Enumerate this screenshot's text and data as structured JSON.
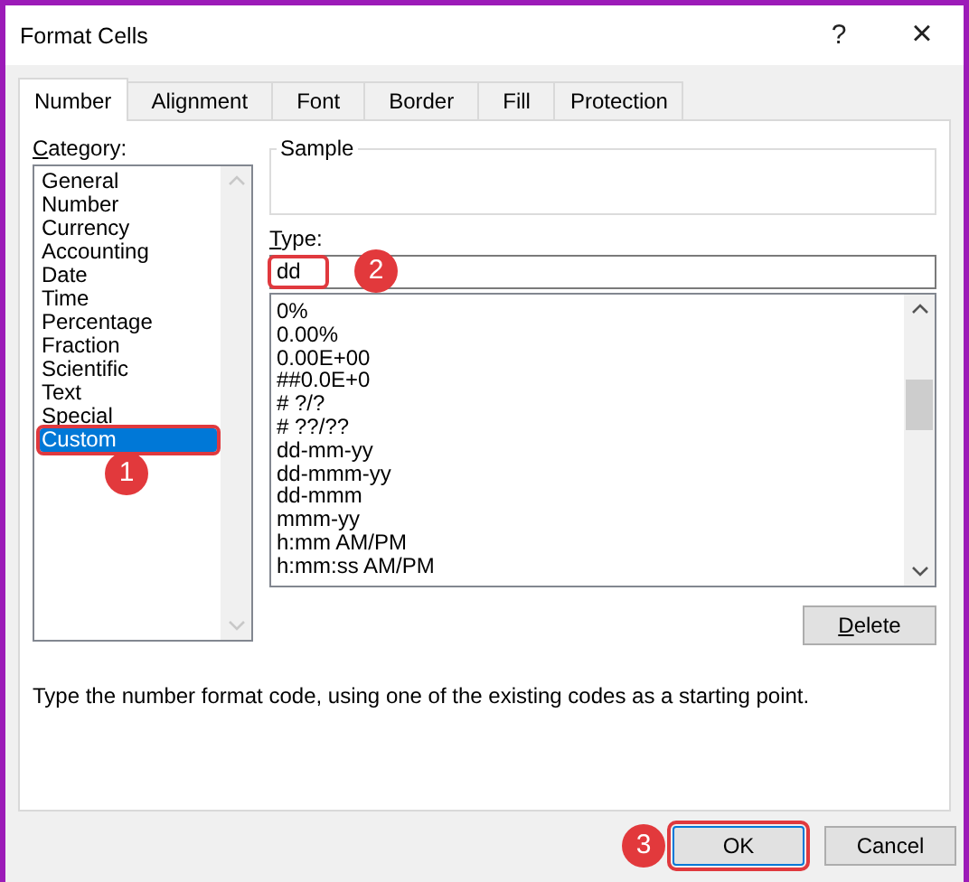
{
  "window": {
    "title": "Format Cells",
    "help": "?",
    "close": "×"
  },
  "tabs": [
    {
      "label": "Number",
      "selected": true
    },
    {
      "label": "Alignment",
      "selected": false
    },
    {
      "label": "Font",
      "selected": false
    },
    {
      "label": "Border",
      "selected": false
    },
    {
      "label": "Fill",
      "selected": false
    },
    {
      "label": "Protection",
      "selected": false
    }
  ],
  "category": {
    "label": {
      "key": "C",
      "rest": "ategory:"
    },
    "items": [
      {
        "label": "General",
        "selected": false,
        "highlighted": false
      },
      {
        "label": "Number",
        "selected": false,
        "highlighted": false
      },
      {
        "label": "Currency",
        "selected": false,
        "highlighted": false
      },
      {
        "label": "Accounting",
        "selected": false,
        "highlighted": false
      },
      {
        "label": "Date",
        "selected": false,
        "highlighted": false
      },
      {
        "label": "Time",
        "selected": false,
        "highlighted": false
      },
      {
        "label": "Percentage",
        "selected": false,
        "highlighted": false
      },
      {
        "label": "Fraction",
        "selected": false,
        "highlighted": false
      },
      {
        "label": "Scientific",
        "selected": false,
        "highlighted": false
      },
      {
        "label": "Text",
        "selected": false,
        "highlighted": false
      },
      {
        "label": "Special",
        "selected": false,
        "highlighted": false
      },
      {
        "label": "Custom",
        "selected": true,
        "highlighted": true,
        "marker": "1"
      }
    ]
  },
  "sample": {
    "label": "Sample"
  },
  "type": {
    "label": {
      "key": "T",
      "rest": "ype:"
    },
    "value": "dd",
    "highlighted": true,
    "marker": "2",
    "items": [
      "0%",
      "0.00%",
      "0.00E+00",
      "##0.0E+0",
      "# ?/?",
      "# ??/??",
      "dd-mm-yy",
      "dd-mmm-yy",
      "dd-mmm",
      "mmm-yy",
      "h:mm AM/PM",
      "h:mm:ss AM/PM"
    ]
  },
  "delete_button": {
    "label": {
      "key": "D",
      "rest": "elete"
    }
  },
  "description": "Type the number format code, using one of the existing codes as a starting point.",
  "buttons": [
    {
      "label": "OK",
      "kind": "primary",
      "highlighted": true,
      "marker": "3"
    },
    {
      "label": "Cancel",
      "kind": "normal",
      "highlighted": false
    }
  ]
}
